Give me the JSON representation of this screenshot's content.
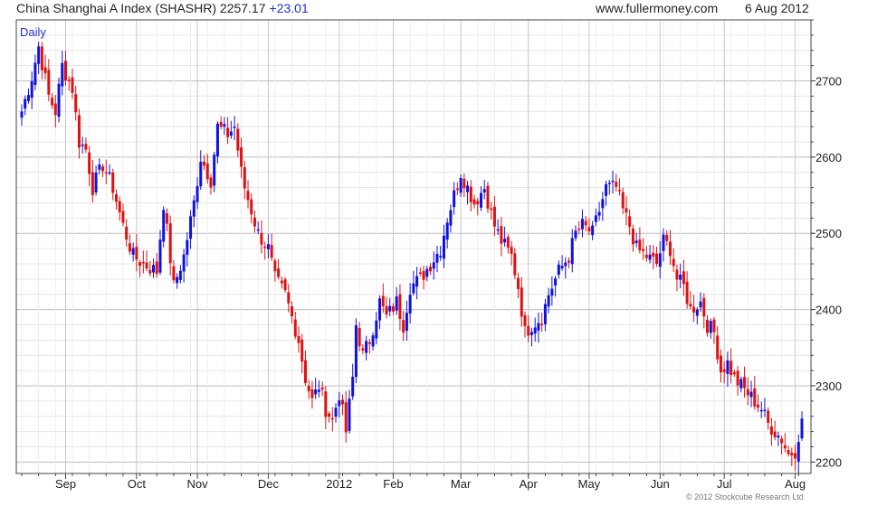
{
  "header": {
    "title": "China Shanghai A Index (SHASHR) 2257.17",
    "change": "+23.01",
    "site": "www.fullermoney.com",
    "date": "6 Aug 2012"
  },
  "copyright": "© 2012 Stockcube Research Ltd",
  "colors": {
    "up": "#1010e0",
    "down": "#e01010",
    "grid": "#cfcfcf",
    "frame": "#444444"
  },
  "chart_data": {
    "type": "candlestick-range-bars",
    "period_label": "Daily",
    "y_ticks": [
      2200,
      2300,
      2400,
      2500,
      2600,
      2700
    ],
    "ylim": [
      2185,
      2780
    ],
    "x_ticks": [
      {
        "label": "Sep",
        "index": 13
      },
      {
        "label": "Oct",
        "index": 34
      },
      {
        "label": "Nov",
        "index": 52
      },
      {
        "label": "Dec",
        "index": 73
      },
      {
        "label": "2012",
        "index": 94
      },
      {
        "label": "Feb",
        "index": 110
      },
      {
        "label": "Mar",
        "index": 130
      },
      {
        "label": "Apr",
        "index": 150
      },
      {
        "label": "May",
        "index": 168
      },
      {
        "label": "Jun",
        "index": 189
      },
      {
        "label": "Jul",
        "index": 208
      },
      {
        "label": "Aug",
        "index": 229
      }
    ],
    "x_count": 232,
    "grid": true,
    "anchors": [
      [
        0,
        2660
      ],
      [
        3,
        2705
      ],
      [
        5,
        2745
      ],
      [
        8,
        2680
      ],
      [
        10,
        2660
      ],
      [
        12,
        2720
      ],
      [
        15,
        2690
      ],
      [
        17,
        2620
      ],
      [
        19,
        2610
      ],
      [
        21,
        2560
      ],
      [
        24,
        2590
      ],
      [
        27,
        2560
      ],
      [
        30,
        2510
      ],
      [
        33,
        2470
      ],
      [
        36,
        2460
      ],
      [
        40,
        2450
      ],
      [
        42,
        2540
      ],
      [
        45,
        2430
      ],
      [
        48,
        2470
      ],
      [
        51,
        2540
      ],
      [
        53,
        2600
      ],
      [
        56,
        2570
      ],
      [
        58,
        2640
      ],
      [
        61,
        2630
      ],
      [
        63,
        2640
      ],
      [
        65,
        2580
      ],
      [
        66,
        2560
      ],
      [
        68,
        2530
      ],
      [
        70,
        2500
      ],
      [
        73,
        2480
      ],
      [
        75,
        2440
      ],
      [
        78,
        2420
      ],
      [
        80,
        2390
      ],
      [
        82,
        2360
      ],
      [
        84,
        2310
      ],
      [
        86,
        2280
      ],
      [
        88,
        2300
      ],
      [
        90,
        2270
      ],
      [
        92,
        2255
      ],
      [
        94,
        2290
      ],
      [
        96,
        2240
      ],
      [
        98,
        2310
      ],
      [
        99,
        2380
      ],
      [
        101,
        2340
      ],
      [
        103,
        2360
      ],
      [
        106,
        2410
      ],
      [
        108,
        2390
      ],
      [
        111,
        2410
      ],
      [
        113,
        2380
      ],
      [
        115,
        2430
      ],
      [
        118,
        2440
      ],
      [
        121,
        2460
      ],
      [
        124,
        2480
      ],
      [
        126,
        2520
      ],
      [
        128,
        2550
      ],
      [
        130,
        2580
      ],
      [
        132,
        2560
      ],
      [
        134,
        2540
      ],
      [
        137,
        2560
      ],
      [
        140,
        2510
      ],
      [
        142,
        2490
      ],
      [
        145,
        2470
      ],
      [
        147,
        2430
      ],
      [
        149,
        2370
      ],
      [
        151,
        2380
      ],
      [
        154,
        2390
      ],
      [
        156,
        2420
      ],
      [
        159,
        2450
      ],
      [
        162,
        2470
      ],
      [
        164,
        2500
      ],
      [
        166,
        2510
      ],
      [
        169,
        2500
      ],
      [
        171,
        2530
      ],
      [
        173,
        2560
      ],
      [
        176,
        2560
      ],
      [
        178,
        2530
      ],
      [
        180,
        2510
      ],
      [
        182,
        2480
      ],
      [
        185,
        2470
      ],
      [
        188,
        2460
      ],
      [
        190,
        2490
      ],
      [
        192,
        2480
      ],
      [
        194,
        2440
      ],
      [
        196,
        2430
      ],
      [
        198,
        2400
      ],
      [
        201,
        2410
      ],
      [
        203,
        2380
      ],
      [
        205,
        2370
      ],
      [
        207,
        2320
      ],
      [
        209,
        2330
      ],
      [
        211,
        2310
      ],
      [
        213,
        2300
      ],
      [
        215,
        2290
      ],
      [
        217,
        2280
      ],
      [
        219,
        2270
      ],
      [
        221,
        2250
      ],
      [
        223,
        2240
      ],
      [
        225,
        2230
      ],
      [
        227,
        2210
      ],
      [
        229,
        2215
      ],
      [
        231,
        2257
      ]
    ]
  }
}
